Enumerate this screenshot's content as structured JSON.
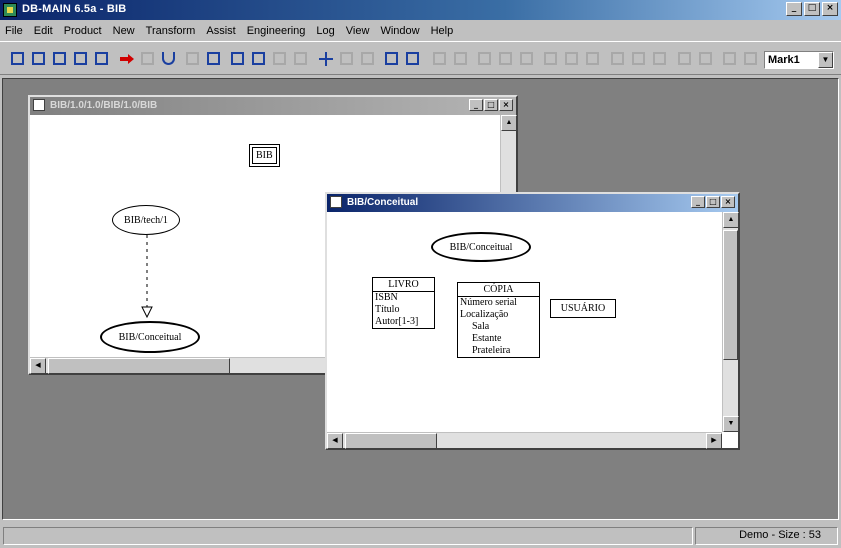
{
  "window": {
    "title": "DB-MAIN 6.5a - BIB"
  },
  "caption_buttons": {
    "minimize": "_",
    "maximize": "□",
    "close": "×"
  },
  "menu": [
    "File",
    "Edit",
    "Product",
    "New",
    "Transform",
    "Assist",
    "Engineering",
    "Log",
    "View",
    "Window",
    "Help"
  ],
  "toolbar": {
    "model_select": "Mark1"
  },
  "windows": {
    "back": {
      "title": "BIB/1.0/1.0/BIB/1.0/BIB",
      "nodes": {
        "top_box": "BIB",
        "ellipse_tech": "BIB/tech/1",
        "ellipse_conceptual": "BIB/Conceitual"
      }
    },
    "front": {
      "title": "BIB/Conceitual",
      "schema_ellipse": "BIB/Conceitual",
      "entities": {
        "livro": {
          "name": "LIVRO",
          "attrs": [
            "ISBN",
            "Título",
            "Autor[1-3]"
          ]
        },
        "copia": {
          "name": "CÓPIA",
          "attrs": [
            "Número serial",
            "Localização"
          ],
          "sub": [
            "Sala",
            "Estante",
            "Prateleira"
          ]
        },
        "usuario": {
          "name": "USUÁRIO"
        }
      }
    }
  },
  "status": {
    "text": "Demo - Size : 53"
  }
}
